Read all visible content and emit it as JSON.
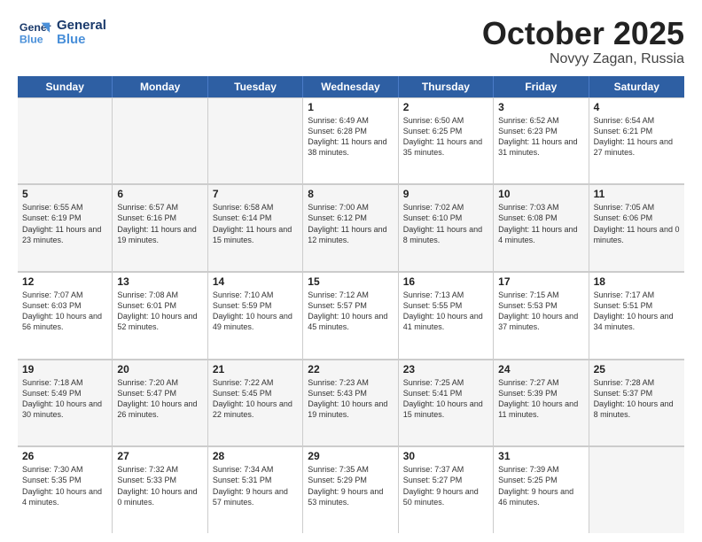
{
  "logo": {
    "line1": "General",
    "line2": "Blue"
  },
  "title": "October 2025",
  "subtitle": "Novyy Zagan, Russia",
  "days_of_week": [
    "Sunday",
    "Monday",
    "Tuesday",
    "Wednesday",
    "Thursday",
    "Friday",
    "Saturday"
  ],
  "weeks": [
    [
      {
        "day": "",
        "empty": true
      },
      {
        "day": "",
        "empty": true
      },
      {
        "day": "",
        "empty": true
      },
      {
        "day": "1",
        "sunrise": "Sunrise: 6:49 AM",
        "sunset": "Sunset: 6:28 PM",
        "daylight": "Daylight: 11 hours and 38 minutes."
      },
      {
        "day": "2",
        "sunrise": "Sunrise: 6:50 AM",
        "sunset": "Sunset: 6:25 PM",
        "daylight": "Daylight: 11 hours and 35 minutes."
      },
      {
        "day": "3",
        "sunrise": "Sunrise: 6:52 AM",
        "sunset": "Sunset: 6:23 PM",
        "daylight": "Daylight: 11 hours and 31 minutes."
      },
      {
        "day": "4",
        "sunrise": "Sunrise: 6:54 AM",
        "sunset": "Sunset: 6:21 PM",
        "daylight": "Daylight: 11 hours and 27 minutes."
      }
    ],
    [
      {
        "day": "5",
        "sunrise": "Sunrise: 6:55 AM",
        "sunset": "Sunset: 6:19 PM",
        "daylight": "Daylight: 11 hours and 23 minutes."
      },
      {
        "day": "6",
        "sunrise": "Sunrise: 6:57 AM",
        "sunset": "Sunset: 6:16 PM",
        "daylight": "Daylight: 11 hours and 19 minutes."
      },
      {
        "day": "7",
        "sunrise": "Sunrise: 6:58 AM",
        "sunset": "Sunset: 6:14 PM",
        "daylight": "Daylight: 11 hours and 15 minutes."
      },
      {
        "day": "8",
        "sunrise": "Sunrise: 7:00 AM",
        "sunset": "Sunset: 6:12 PM",
        "daylight": "Daylight: 11 hours and 12 minutes."
      },
      {
        "day": "9",
        "sunrise": "Sunrise: 7:02 AM",
        "sunset": "Sunset: 6:10 PM",
        "daylight": "Daylight: 11 hours and 8 minutes."
      },
      {
        "day": "10",
        "sunrise": "Sunrise: 7:03 AM",
        "sunset": "Sunset: 6:08 PM",
        "daylight": "Daylight: 11 hours and 4 minutes."
      },
      {
        "day": "11",
        "sunrise": "Sunrise: 7:05 AM",
        "sunset": "Sunset: 6:06 PM",
        "daylight": "Daylight: 11 hours and 0 minutes."
      }
    ],
    [
      {
        "day": "12",
        "sunrise": "Sunrise: 7:07 AM",
        "sunset": "Sunset: 6:03 PM",
        "daylight": "Daylight: 10 hours and 56 minutes."
      },
      {
        "day": "13",
        "sunrise": "Sunrise: 7:08 AM",
        "sunset": "Sunset: 6:01 PM",
        "daylight": "Daylight: 10 hours and 52 minutes."
      },
      {
        "day": "14",
        "sunrise": "Sunrise: 7:10 AM",
        "sunset": "Sunset: 5:59 PM",
        "daylight": "Daylight: 10 hours and 49 minutes."
      },
      {
        "day": "15",
        "sunrise": "Sunrise: 7:12 AM",
        "sunset": "Sunset: 5:57 PM",
        "daylight": "Daylight: 10 hours and 45 minutes."
      },
      {
        "day": "16",
        "sunrise": "Sunrise: 7:13 AM",
        "sunset": "Sunset: 5:55 PM",
        "daylight": "Daylight: 10 hours and 41 minutes."
      },
      {
        "day": "17",
        "sunrise": "Sunrise: 7:15 AM",
        "sunset": "Sunset: 5:53 PM",
        "daylight": "Daylight: 10 hours and 37 minutes."
      },
      {
        "day": "18",
        "sunrise": "Sunrise: 7:17 AM",
        "sunset": "Sunset: 5:51 PM",
        "daylight": "Daylight: 10 hours and 34 minutes."
      }
    ],
    [
      {
        "day": "19",
        "sunrise": "Sunrise: 7:18 AM",
        "sunset": "Sunset: 5:49 PM",
        "daylight": "Daylight: 10 hours and 30 minutes."
      },
      {
        "day": "20",
        "sunrise": "Sunrise: 7:20 AM",
        "sunset": "Sunset: 5:47 PM",
        "daylight": "Daylight: 10 hours and 26 minutes."
      },
      {
        "day": "21",
        "sunrise": "Sunrise: 7:22 AM",
        "sunset": "Sunset: 5:45 PM",
        "daylight": "Daylight: 10 hours and 22 minutes."
      },
      {
        "day": "22",
        "sunrise": "Sunrise: 7:23 AM",
        "sunset": "Sunset: 5:43 PM",
        "daylight": "Daylight: 10 hours and 19 minutes."
      },
      {
        "day": "23",
        "sunrise": "Sunrise: 7:25 AM",
        "sunset": "Sunset: 5:41 PM",
        "daylight": "Daylight: 10 hours and 15 minutes."
      },
      {
        "day": "24",
        "sunrise": "Sunrise: 7:27 AM",
        "sunset": "Sunset: 5:39 PM",
        "daylight": "Daylight: 10 hours and 11 minutes."
      },
      {
        "day": "25",
        "sunrise": "Sunrise: 7:28 AM",
        "sunset": "Sunset: 5:37 PM",
        "daylight": "Daylight: 10 hours and 8 minutes."
      }
    ],
    [
      {
        "day": "26",
        "sunrise": "Sunrise: 7:30 AM",
        "sunset": "Sunset: 5:35 PM",
        "daylight": "Daylight: 10 hours and 4 minutes."
      },
      {
        "day": "27",
        "sunrise": "Sunrise: 7:32 AM",
        "sunset": "Sunset: 5:33 PM",
        "daylight": "Daylight: 10 hours and 0 minutes."
      },
      {
        "day": "28",
        "sunrise": "Sunrise: 7:34 AM",
        "sunset": "Sunset: 5:31 PM",
        "daylight": "Daylight: 9 hours and 57 minutes."
      },
      {
        "day": "29",
        "sunrise": "Sunrise: 7:35 AM",
        "sunset": "Sunset: 5:29 PM",
        "daylight": "Daylight: 9 hours and 53 minutes."
      },
      {
        "day": "30",
        "sunrise": "Sunrise: 7:37 AM",
        "sunset": "Sunset: 5:27 PM",
        "daylight": "Daylight: 9 hours and 50 minutes."
      },
      {
        "day": "31",
        "sunrise": "Sunrise: 7:39 AM",
        "sunset": "Sunset: 5:25 PM",
        "daylight": "Daylight: 9 hours and 46 minutes."
      },
      {
        "day": "",
        "empty": true
      }
    ]
  ]
}
